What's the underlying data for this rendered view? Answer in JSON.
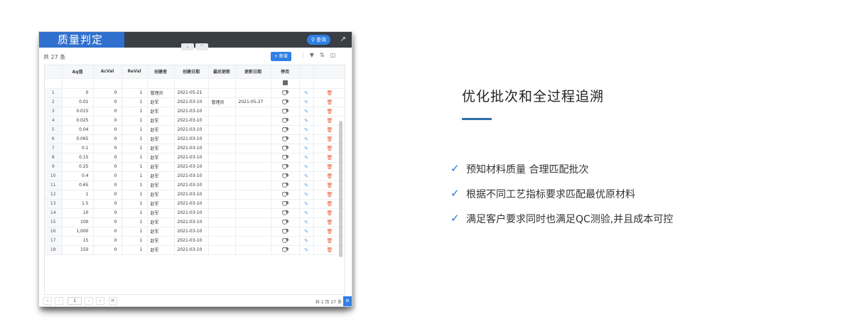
{
  "window": {
    "title": "质量判定",
    "collapse_tabs": [
      "⌄",
      "⌃"
    ],
    "search_label": "查询",
    "record_count": "共 27 条",
    "add_label": "+ 新增"
  },
  "table": {
    "columns": [
      "",
      "Aq值",
      "AcVal",
      "ReVal",
      "创建者",
      "创建日期",
      "最后更新",
      "更新日期",
      "停用",
      "",
      ""
    ],
    "rows": [
      [
        "1",
        "0",
        "0",
        "1",
        "管理员",
        "2021-05-21",
        "",
        ""
      ],
      [
        "2",
        "0.01",
        "0",
        "1",
        "赵军",
        "2021-03-10",
        "管理员",
        "2021-05-27"
      ],
      [
        "3",
        "0.015",
        "0",
        "1",
        "赵军",
        "2021-03-10",
        "",
        ""
      ],
      [
        "4",
        "0.025",
        "0",
        "1",
        "赵军",
        "2021-03-10",
        "",
        ""
      ],
      [
        "5",
        "0.04",
        "0",
        "1",
        "赵军",
        "2021-03-10",
        "",
        ""
      ],
      [
        "6",
        "0.065",
        "0",
        "1",
        "赵军",
        "2021-03-10",
        "",
        ""
      ],
      [
        "7",
        "0.1",
        "0",
        "1",
        "赵军",
        "2021-03-10",
        "",
        ""
      ],
      [
        "8",
        "0.15",
        "0",
        "1",
        "赵军",
        "2021-03-10",
        "",
        ""
      ],
      [
        "9",
        "0.25",
        "0",
        "1",
        "赵军",
        "2021-03-10",
        "",
        ""
      ],
      [
        "10",
        "0.4",
        "0",
        "1",
        "赵军",
        "2021-03-10",
        "",
        ""
      ],
      [
        "11",
        "0.65",
        "0",
        "1",
        "赵军",
        "2021-03-10",
        "",
        ""
      ],
      [
        "12",
        "1",
        "0",
        "1",
        "赵军",
        "2021-03-10",
        "",
        ""
      ],
      [
        "13",
        "1.5",
        "0",
        "1",
        "赵军",
        "2021-03-10",
        "",
        ""
      ],
      [
        "14",
        "10",
        "0",
        "1",
        "赵军",
        "2021-03-10",
        "",
        ""
      ],
      [
        "15",
        "100",
        "0",
        "1",
        "赵军",
        "2021-03-10",
        "",
        ""
      ],
      [
        "16",
        "1,000",
        "0",
        "1",
        "赵军",
        "2021-03-10",
        "",
        ""
      ],
      [
        "17",
        "15",
        "0",
        "1",
        "赵军",
        "2021-03-10",
        "",
        ""
      ],
      [
        "18",
        "150",
        "0",
        "1",
        "赵军",
        "2021-03-10",
        "",
        ""
      ]
    ]
  },
  "pager": {
    "page": "1",
    "total": "共 1 页 27 条"
  },
  "panel": {
    "headline": "优化批次和全过程追溯",
    "features": [
      "预知材料质量 合理匹配批次",
      "根据不同工艺指标要求匹配最优原材料",
      "满足客户要求同时也满足QC测验,并且成本可控"
    ]
  },
  "colors": {
    "title_blue": "#2f6fce",
    "titlebar_dark": "#3a3f45",
    "button_blue": "#2f7fe6",
    "delete_red": "#e8603c",
    "accent_bar": "#2f6fa8",
    "check_blue": "#2a74c9"
  }
}
